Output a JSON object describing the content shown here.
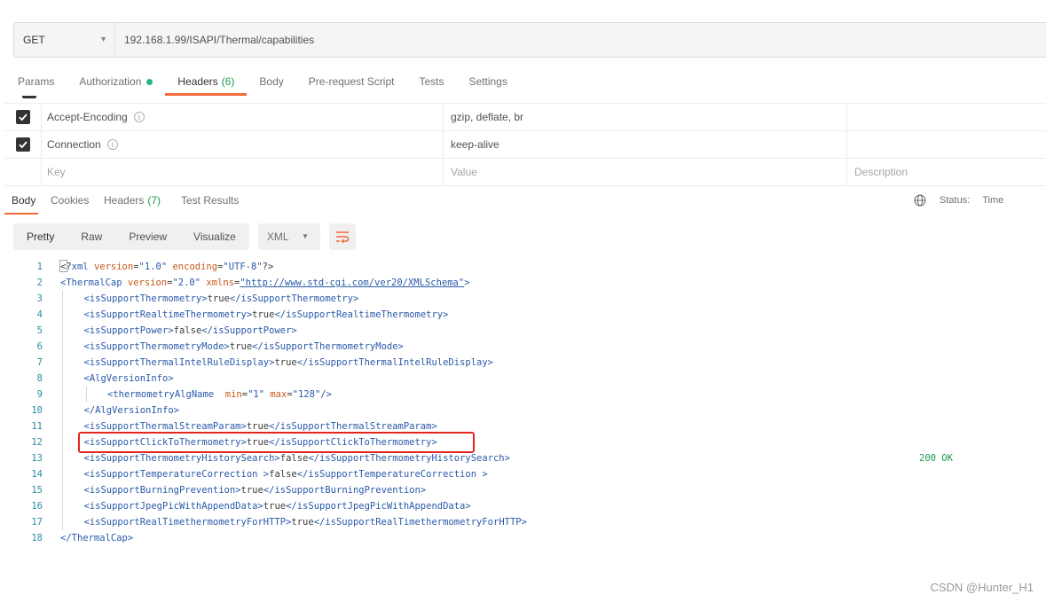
{
  "request": {
    "method": "GET",
    "url": "192.168.1.99/ISAPI/Thermal/capabilities"
  },
  "request_tabs": [
    {
      "label": "Params"
    },
    {
      "label": "Authorization",
      "indicator": "green-dot"
    },
    {
      "label": "Headers",
      "count": "(6)",
      "active": true
    },
    {
      "label": "Body"
    },
    {
      "label": "Pre-request Script"
    },
    {
      "label": "Tests"
    },
    {
      "label": "Settings"
    }
  ],
  "headers_table": {
    "rows": [
      {
        "key": "Accept-Encoding",
        "value": "gzip, deflate, br",
        "checked": true
      },
      {
        "key": "Connection",
        "value": "keep-alive",
        "checked": true
      }
    ],
    "placeholder": {
      "key": "Key",
      "value": "Value",
      "description": "Description"
    }
  },
  "response_tabs": [
    {
      "label": "Body",
      "active": true
    },
    {
      "label": "Cookies"
    },
    {
      "label": "Headers",
      "count": "(7)"
    },
    {
      "label": "Test Results"
    }
  ],
  "response_status": {
    "label": "Status:",
    "code": "200 OK",
    "time_label": "Time"
  },
  "view_modes": [
    "Pretty",
    "Raw",
    "Preview",
    "Visualize"
  ],
  "format": "XML",
  "code_lines": [
    {
      "n": "1",
      "indent": 0,
      "content": [
        [
          "p",
          "<?"
        ],
        [
          "t",
          "xml"
        ],
        [
          "p",
          " "
        ],
        [
          "a",
          "version"
        ],
        [
          "p",
          "="
        ],
        [
          "v",
          "\"1.0\""
        ],
        [
          "p",
          " "
        ],
        [
          "a",
          "encoding"
        ],
        [
          "p",
          "="
        ],
        [
          "v",
          "\"UTF-8\""
        ],
        [
          "p",
          "?>"
        ]
      ]
    },
    {
      "n": "2",
      "indent": 0,
      "content": [
        [
          "t",
          "<ThermalCap"
        ],
        [
          "p",
          " "
        ],
        [
          "a",
          "version"
        ],
        [
          "p",
          "="
        ],
        [
          "v",
          "\"2.0\""
        ],
        [
          "p",
          " "
        ],
        [
          "a",
          "xmlns"
        ],
        [
          "p",
          "="
        ],
        [
          "l",
          "\"http://www.std-cgi.com/ver20/XMLSchema\""
        ],
        [
          "t",
          ">"
        ]
      ]
    },
    {
      "n": "3",
      "indent": 1,
      "content": [
        [
          "t",
          "<isSupportThermometry>"
        ],
        [
          "p",
          "true"
        ],
        [
          "t",
          "</isSupportThermometry>"
        ]
      ]
    },
    {
      "n": "4",
      "indent": 1,
      "content": [
        [
          "t",
          "<isSupportRealtimeThermometry>"
        ],
        [
          "p",
          "true"
        ],
        [
          "t",
          "</isSupportRealtimeThermometry>"
        ]
      ]
    },
    {
      "n": "5",
      "indent": 1,
      "content": [
        [
          "t",
          "<isSupportPower>"
        ],
        [
          "p",
          "false"
        ],
        [
          "t",
          "</isSupportPower>"
        ]
      ]
    },
    {
      "n": "6",
      "indent": 1,
      "content": [
        [
          "t",
          "<isSupportThermometryMode>"
        ],
        [
          "p",
          "true"
        ],
        [
          "t",
          "</isSupportThermometryMode>"
        ]
      ]
    },
    {
      "n": "7",
      "indent": 1,
      "content": [
        [
          "t",
          "<isSupportThermalIntelRuleDisplay>"
        ],
        [
          "p",
          "true"
        ],
        [
          "t",
          "</isSupportThermalIntelRuleDisplay>"
        ]
      ]
    },
    {
      "n": "8",
      "indent": 1,
      "content": [
        [
          "t",
          "<AlgVersionInfo>"
        ]
      ]
    },
    {
      "n": "9",
      "indent": 2,
      "content": [
        [
          "t",
          "<thermometryAlgName"
        ],
        [
          "p",
          "  "
        ],
        [
          "a",
          "min"
        ],
        [
          "p",
          "="
        ],
        [
          "v",
          "\"1\""
        ],
        [
          "p",
          " "
        ],
        [
          "a",
          "max"
        ],
        [
          "p",
          "="
        ],
        [
          "v",
          "\"128\""
        ],
        [
          "t",
          "/>"
        ]
      ]
    },
    {
      "n": "10",
      "indent": 1,
      "content": [
        [
          "t",
          "</AlgVersionInfo>"
        ]
      ]
    },
    {
      "n": "11",
      "indent": 1,
      "content": [
        [
          "t",
          "<isSupportThermalStreamParam>"
        ],
        [
          "p",
          "true"
        ],
        [
          "t",
          "</isSupportThermalStreamParam>"
        ]
      ]
    },
    {
      "n": "12",
      "indent": 1,
      "content": [
        [
          "t",
          "<isSupportClickToThermometry>"
        ],
        [
          "p",
          "true"
        ],
        [
          "t",
          "</isSupportClickToThermometry>"
        ]
      ]
    },
    {
      "n": "13",
      "indent": 1,
      "content": [
        [
          "t",
          "<isSupportThermometryHistorySearch>"
        ],
        [
          "p",
          "false"
        ],
        [
          "t",
          "</isSupportThermometryHistorySearch>"
        ]
      ]
    },
    {
      "n": "14",
      "indent": 1,
      "content": [
        [
          "t",
          "<isSupportTemperatureCorrection "
        ],
        [
          "t",
          ">"
        ],
        [
          "p",
          "false"
        ],
        [
          "t",
          "</isSupportTemperatureCorrection >"
        ]
      ]
    },
    {
      "n": "15",
      "indent": 1,
      "content": [
        [
          "t",
          "<isSupportBurningPrevention>"
        ],
        [
          "p",
          "true"
        ],
        [
          "t",
          "</isSupportBurningPrevention>"
        ]
      ]
    },
    {
      "n": "16",
      "indent": 1,
      "content": [
        [
          "t",
          "<isSupportJpegPicWithAppendData>"
        ],
        [
          "p",
          "true"
        ],
        [
          "t",
          "</isSupportJpegPicWithAppendData>"
        ]
      ]
    },
    {
      "n": "17",
      "indent": 1,
      "content": [
        [
          "t",
          "<isSupportRealTimethermometryForHTTP>"
        ],
        [
          "p",
          "true"
        ],
        [
          "t",
          "</isSupportRealTimethermometryForHTTP>"
        ]
      ]
    },
    {
      "n": "18",
      "indent": 0,
      "content": [
        [
          "t",
          "</ThermalCap>"
        ]
      ]
    }
  ],
  "highlighted_line": "12",
  "watermark": "CSDN @Hunter_H1",
  "colors": {
    "accent": "#f26b3a",
    "status_ok": "#1d9a4b",
    "highlight_box": "#e3261f",
    "xml_tag": "#2a5aa8",
    "xml_attr": "#c75a1a"
  }
}
